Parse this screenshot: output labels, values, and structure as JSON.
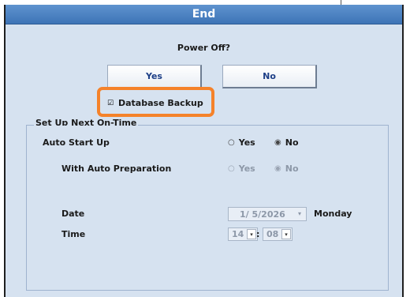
{
  "window": {
    "title": "End"
  },
  "dialog": {
    "prompt": "Power Off?",
    "yes_label": "Yes",
    "no_label": "No",
    "database_backup": {
      "label": "Database Backup",
      "checked": true,
      "mark": "☑"
    }
  },
  "next_on_time": {
    "group_title": "Set Up Next On-Time",
    "auto_start_up": {
      "label": "Auto Start Up",
      "yes_label": "Yes",
      "no_label": "No",
      "selected": "No",
      "mark_on": "◉",
      "mark_off": "○"
    },
    "auto_preparation": {
      "label": "With Auto Preparation",
      "yes_label": "Yes",
      "no_label": "No",
      "selected": "No",
      "enabled": false,
      "mark_on": "◉",
      "mark_off": "○"
    },
    "date": {
      "label": "Date",
      "value": "1/ 5/2026",
      "day": "Monday",
      "dropdown_glyph": "▾"
    },
    "time": {
      "label": "Time",
      "hour": "14",
      "minute": "08",
      "separator": ":",
      "dropdown_glyph": "▾"
    }
  },
  "colors": {
    "title_bar": "#3d74b6",
    "panel_bg": "#d6e2f0",
    "highlight": "#f5822a",
    "button_text": "#1d3f87"
  }
}
